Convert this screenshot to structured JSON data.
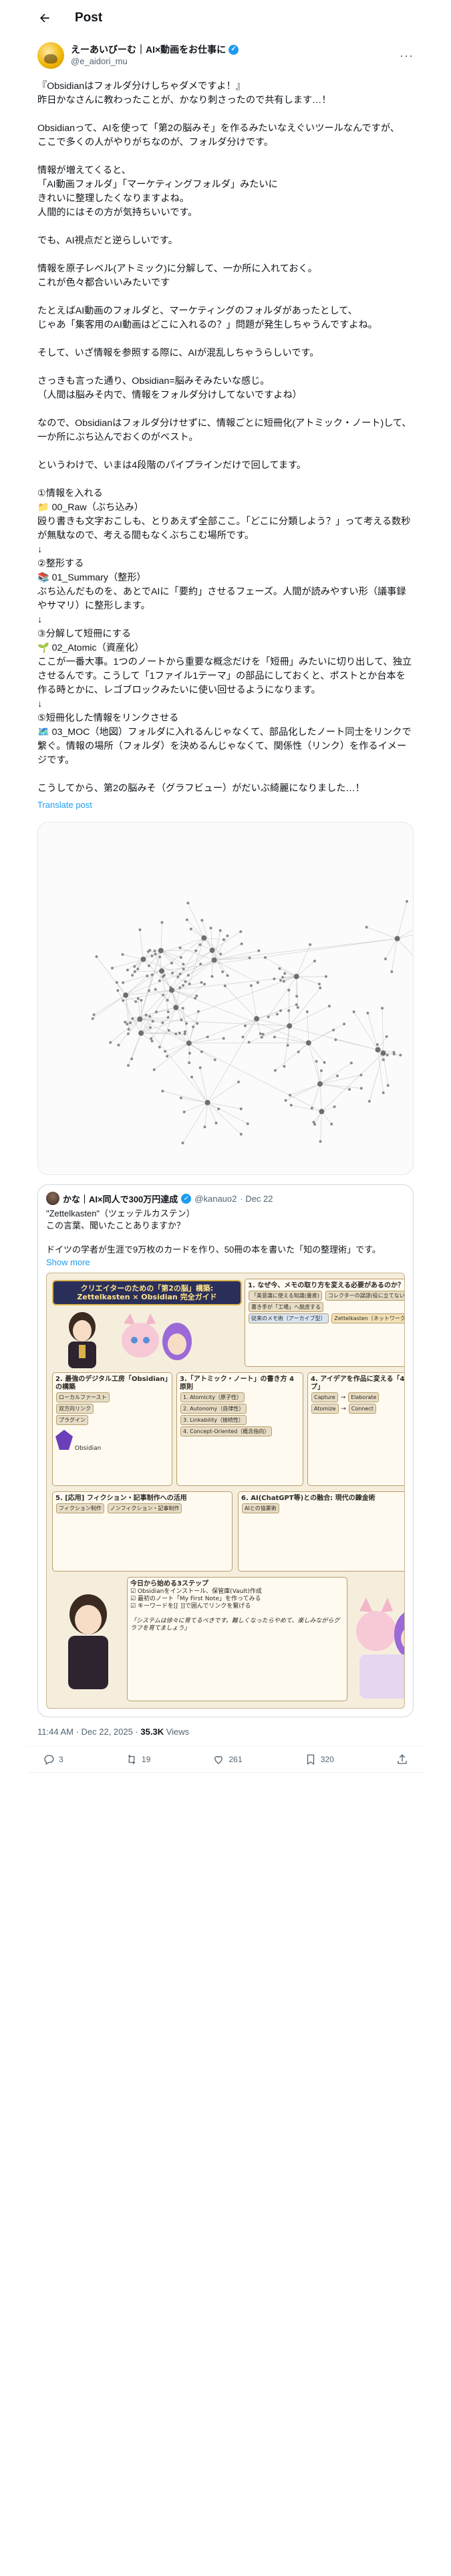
{
  "header": {
    "title": "Post"
  },
  "author": {
    "name": "えーあいびーむ｜AI×動画をお仕事に",
    "handle": "@e_aidori_mu"
  },
  "tweet": {
    "text": "『Obsidianはフォルダ分けしちゃダメですよ！』\n昨日かなさんに教わったことが、かなり刺さったので共有します…！\n\nObsidianって、AIを使って「第2の脳みそ」を作るみたいなえぐいツールなんですが、\nここで多くの人がやりがちなのが、フォルダ分けです。\n\n情報が増えてくると、\n「AI動画フォルダ」「マーケティングフォルダ」みたいに\nきれいに整理したくなりますよね。\n人間的にはその方が気持ちいいです。\n\nでも、AI視点だと逆らしいです。\n\n情報を原子レベル(アトミック)に分解して、一か所に入れておく。\nこれが色々都合いいみたいです\n\nたとえばAI動画のフォルダと、マーケティングのフォルダがあったとして、\nじゃあ「集客用のAI動画はどこに入れるの？」問題が発生しちゃうんですよね。\n\nそして、いざ情報を参照する際に、AIが混乱しちゃうらしいです。\n\nさっきも言った通り、Obsidian=脳みそみたいな感じ。\n（人間は脳みそ内で、情報をフォルダ分けしてないですよね）\n\nなので、Obsidianはフォルダ分けせずに、情報ごとに短冊化(アトミック・ノート)して、一か所にぶち込んでおくのがベスト。\n\nというわけで、いまは4段階のパイプラインだけで回してます。\n\n①情報を入れる\n📁 00_Raw（ぶち込み）\n殴り書きも文字おこしも、とりあえず全部ここ。「どこに分類しよう？」って考える数秒が無駄なので、考える間もなくぶちこむ場所です。\n↓\n②整形する\n📚 01_Summary（整形）\nぶち込んだものを、あとでAIに「要約」させるフェーズ。人間が読みやすい形（議事録やサマリ）に整形します。\n↓\n③分解して短冊にする\n🌱 02_Atomic（資産化）\nここが一番大事。1つのノートから重要な概念だけを「短冊」みたいに切り出して、独立させるんです。こうして「1ファイル1テーマ」の部品にしておくと、ポストとか台本を作る時とかに、レゴブロックみたいに使い回せるようになります。\n↓\n⑤短冊化した情報をリンクさせる\n🗺️ 03_MOC（地図）フォルダに入れるんじゃなくて、部品化したノート同士をリンクで繋ぐ。情報の場所（フォルダ）を決めるんじゃなくて、関係性（リンク）を作るイメージです。\n\nこうしてから、第2の脳みそ（グラフビュー）がだいぶ綺麗になりました…！",
    "translate": "Translate post"
  },
  "quote": {
    "name": "かな｜AI×同人で300万円達成",
    "handle": "@kanauo2",
    "date": "· Dec 22",
    "text": "\"Zettelkasten\"（ツェッテルカステン）\nこの言葉、聞いたことありますか？\n\nドイツの学者が生涯で9万枚のカードを作り、50冊の本を書いた「知の整理術」です。",
    "show_more": "Show more",
    "infographic": {
      "banner": "クリエイターのための「第2の脳」構築:\nZettelkasten × Obsidian 完全ガイド",
      "s1": "1. なぜ今、メモの取り方を変える必要があるのか？",
      "s1_a": "「美意識に使える知識(量産)",
      "s1_b": "コレクターの誤謬(役に立てない)",
      "s1_c": "書き手が「工場」へ脱皮する",
      "s1_compare_left": "従来のメモ術（アーカイブ型）",
      "s1_compare_right": "Zettelkasten（ネットワーク型）",
      "s2": "2. 最強のデジタル工房「Obsidian」の構築",
      "s2_a": "ローカルファースト",
      "s2_b": "双方向リンク",
      "s2_c": "プラグイン",
      "s2_name": "Obsidian",
      "s3": "3.「アトミック・ノート」の書き方 4原則",
      "s3_a": "1. Atomicity（原子性）",
      "s3_b": "2. Autonomy（自律性）",
      "s3_c": "3. Linkability（接続性）",
      "s3_d": "4. Concept-Oriented（概念指向）",
      "s4": "4. アイデアを作品に変える「4ステップ」",
      "s4_a": "Capture",
      "s4_b": "Elaborate",
      "s4_c": "Atomize",
      "s4_d": "Connect",
      "s5": "5. [応用] フィクション・記事制作への活用",
      "s5_a": "フィクション制作",
      "s5_b": "ノンフィクション・記事制作",
      "s6": "6. AI(ChatGPT等)との融合: 現代の錬金術",
      "s6_a": "AIとの協業術",
      "s7": "今日から始める3ステップ",
      "s7_a": "Obsidianをインストール、保管庫(Vault)作成",
      "s7_b": "最初のノート「My First Note」を作ってみる",
      "s7_c": "キーワードを[[ ]]で囲んでリンクを繋げる",
      "s7_quote": "「システムは徐々に育てるべきです。難しくなったらやめて、楽しみながらグラフを育てましょう」"
    }
  },
  "meta": {
    "time": "11:44 AM · Dec 22, 2025 · ",
    "views_count": "35.3K",
    "views_label": " Views"
  },
  "actions": {
    "replies": "3",
    "reposts": "19",
    "likes": "261",
    "bookmarks": "320"
  }
}
